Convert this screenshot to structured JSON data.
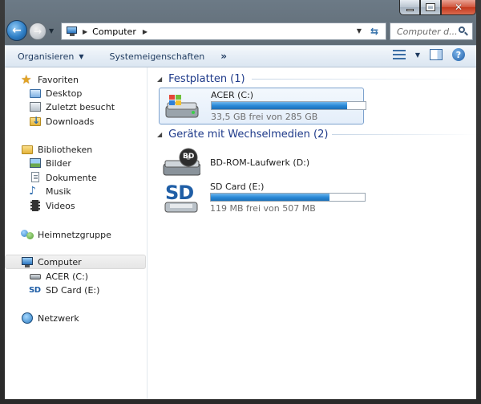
{
  "window": {
    "caption": {
      "minimize_label": "",
      "maximize_label": "",
      "close_label": "✕"
    }
  },
  "address": {
    "path_label": "Computer",
    "search_placeholder": "Computer d..."
  },
  "commandbar": {
    "organize": "Organisieren",
    "system_properties": "Systemeigenschaften",
    "more": "»"
  },
  "navpane": {
    "favorites": "Favoriten",
    "desktop": "Desktop",
    "recent": "Zuletzt besucht",
    "downloads": "Downloads",
    "libraries": "Bibliotheken",
    "pictures": "Bilder",
    "documents": "Dokumente",
    "music": "Musik",
    "videos": "Videos",
    "homegroup": "Heimnetzgruppe",
    "computer": "Computer",
    "drive_c": "ACER (C:)",
    "drive_e": "SD Card (E:)",
    "network": "Netzwerk"
  },
  "main": {
    "hdd_group": "Festplatten (1)",
    "removable_group": "Geräte mit Wechselmedien (2)",
    "drives": [
      {
        "name": "ACER (C:)",
        "free_text": "33,5 GB frei von 285 GB",
        "used_fraction": 0.88
      },
      {
        "name": "BD-ROM-Laufwerk (D:)"
      },
      {
        "name": "SD Card (E:)",
        "free_text": "119 MB frei von 507 MB",
        "used_fraction": 0.77
      }
    ],
    "bd_badge": "BD",
    "sd_logo": "SD"
  },
  "colors": {
    "accent": "#1e3a8a",
    "bar_fill": "#2a8ad8",
    "frame": "#2a2a2a"
  }
}
